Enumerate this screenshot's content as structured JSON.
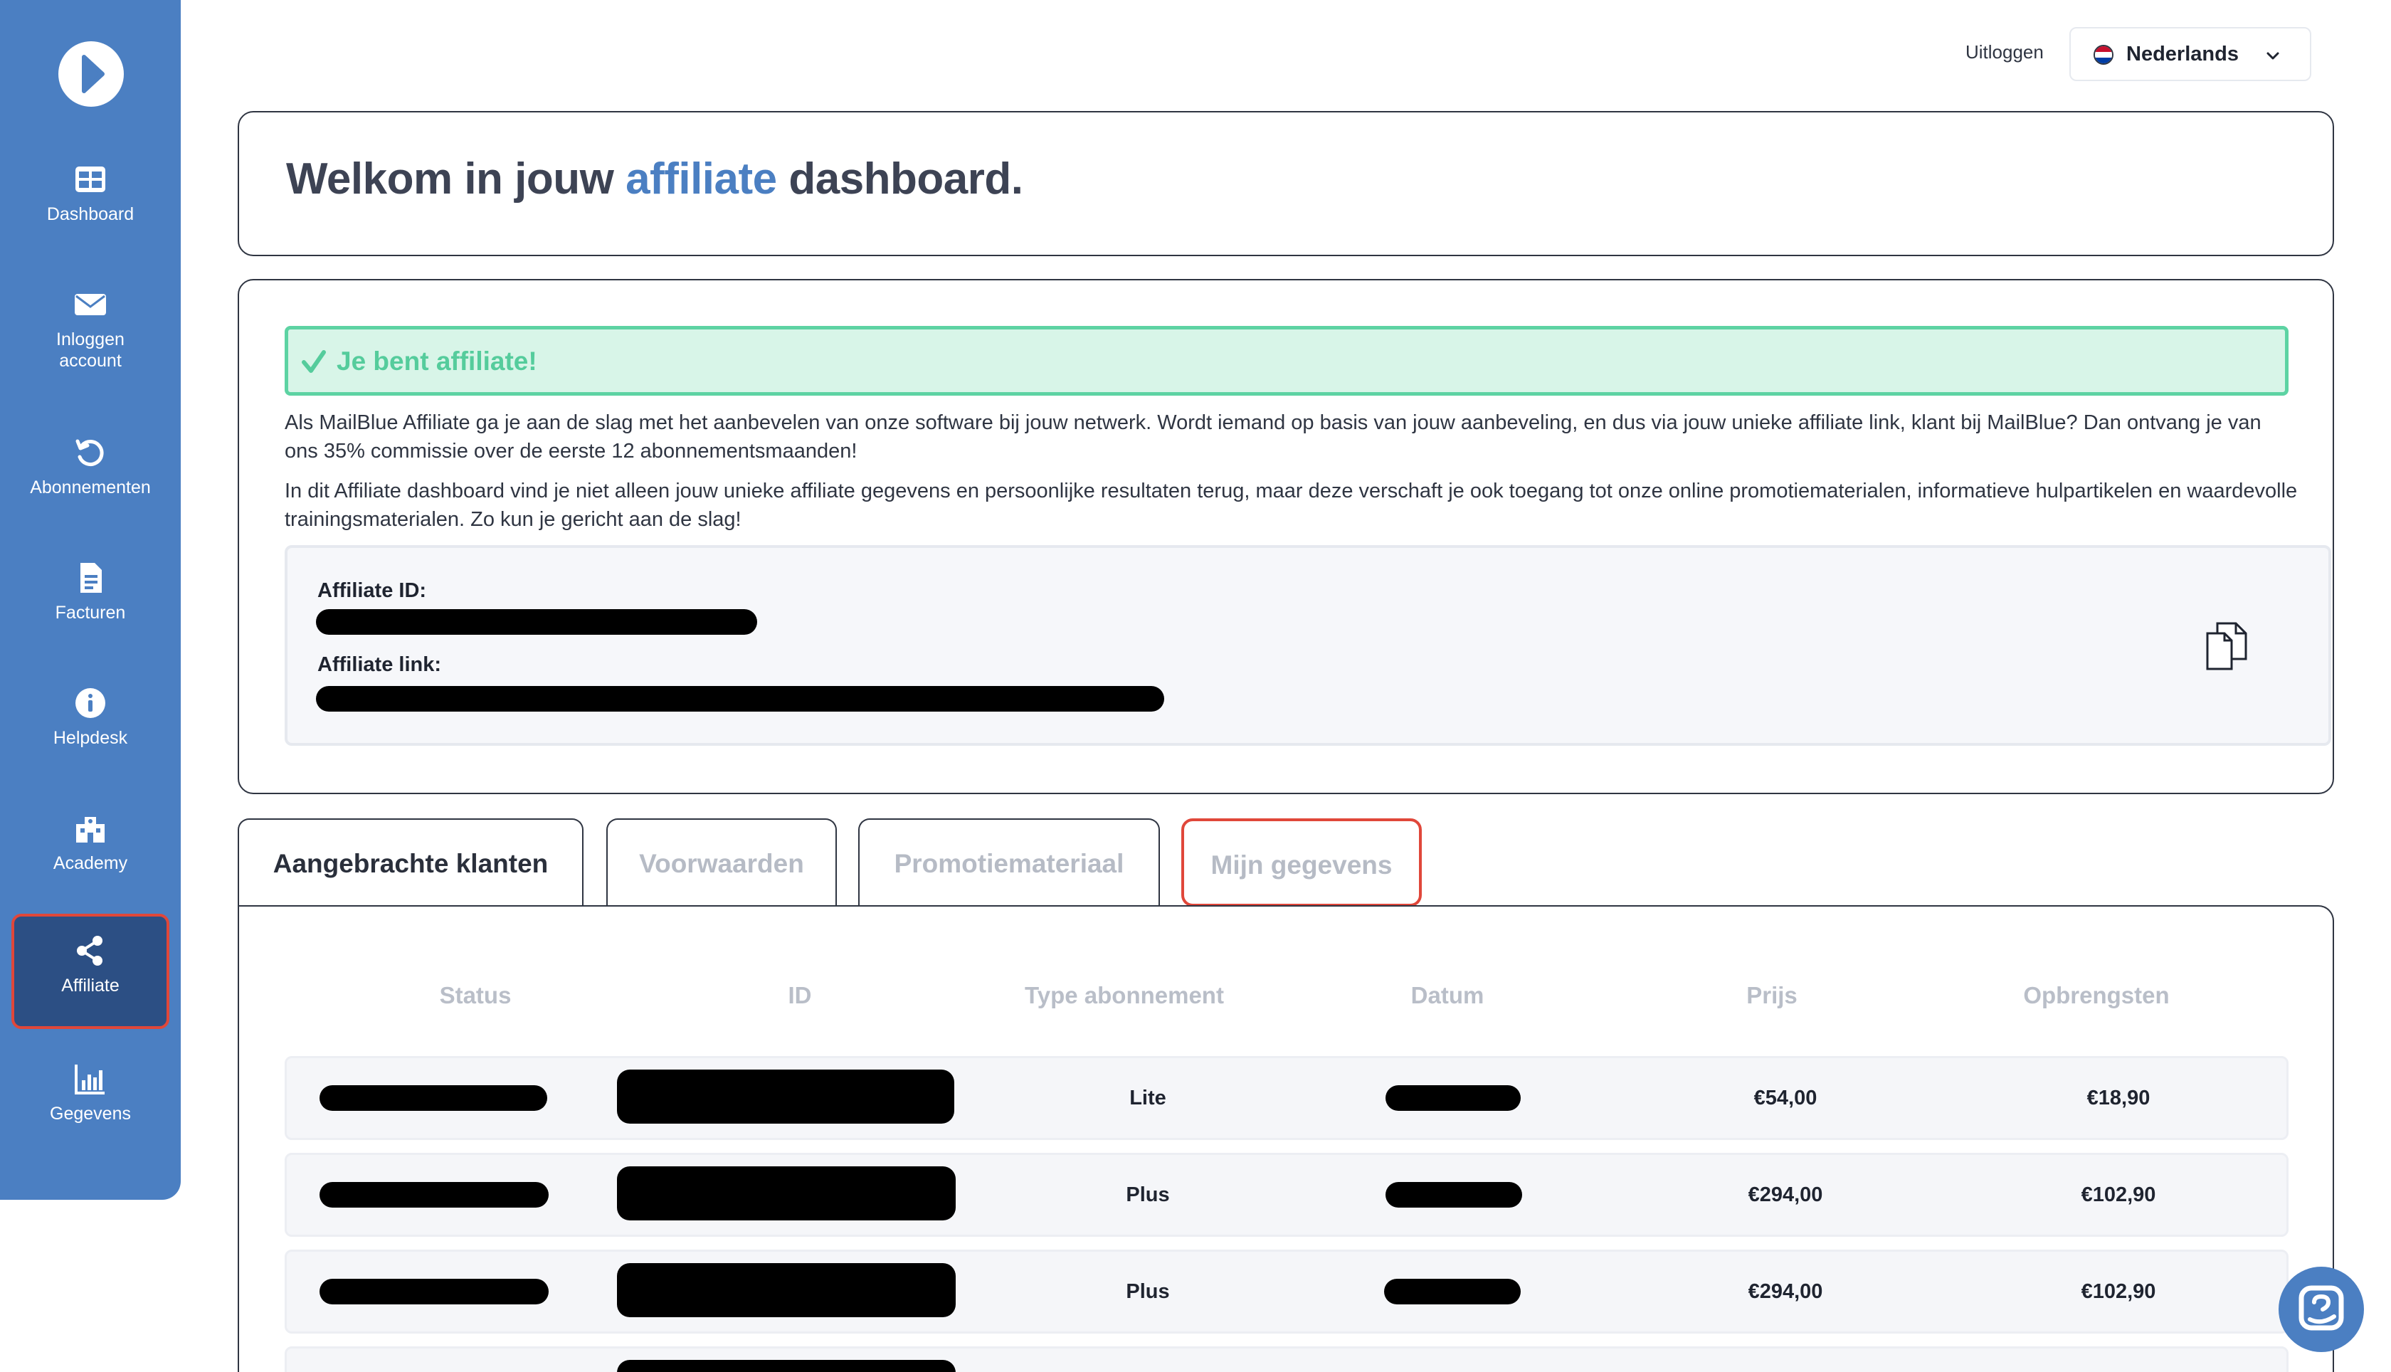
{
  "sidebar": {
    "items": [
      {
        "label": "Dashboard",
        "icon": "grid-icon"
      },
      {
        "label": "Inloggen account",
        "icon": "envelope-icon"
      },
      {
        "label": "Abonnementen",
        "icon": "refresh-icon"
      },
      {
        "label": "Facturen",
        "icon": "document-icon"
      },
      {
        "label": "Helpdesk",
        "icon": "info-icon"
      },
      {
        "label": "Academy",
        "icon": "academy-icon"
      },
      {
        "label": "Affiliate",
        "icon": "share-icon"
      },
      {
        "label": "Gegevens",
        "icon": "bar-chart-icon"
      }
    ],
    "active": "Affiliate",
    "bg_color": "#4b7fc2",
    "active_color": "#2c4f84"
  },
  "header": {
    "logout_label": "Uitloggen",
    "language": "Nederlands"
  },
  "welcome": {
    "title_part1": "Welkom in jouw ",
    "title_accent": "affiliate",
    "title_part2": " dashboard."
  },
  "affiliate_info": {
    "status": "Je bent affiliate!",
    "paragraph1": "Als MailBlue Affiliate ga je aan de slag met het aanbevelen van onze software bij jouw netwerk. Wordt iemand op basis van jouw aanbeveling, en dus via jouw unieke affiliate link, klant bij MailBlue? Dan ontvang je van ons 35% commissie over de eerste 12 abonnementsmaanden!",
    "paragraph2": "In dit Affiliate dashboard vind je niet alleen jouw unieke affiliate gegevens en persoonlijke resultaten terug, maar deze verschaft je ook toegang tot onze online promotiematerialen, informatieve hulpartikelen en waardevolle trainingsmaterialen. Zo kun je gericht aan de slag!",
    "id_label": "Affiliate ID:",
    "link_label": "Affiliate link:"
  },
  "tabs": [
    {
      "label": "Aangebrachte klanten",
      "active": true
    },
    {
      "label": "Voorwaarden",
      "active": false
    },
    {
      "label": "Promotiemateriaal",
      "active": false
    },
    {
      "label": "Mijn gegevens",
      "active": false
    }
  ],
  "table": {
    "columns": [
      "Status",
      "ID",
      "Type abonnement",
      "Datum",
      "Prijs",
      "Opbrengsten"
    ],
    "rows": [
      {
        "type": "Lite",
        "price": "€54,00",
        "revenue": "€18,90"
      },
      {
        "type": "Plus",
        "price": "€294,00",
        "revenue": "€102,90"
      },
      {
        "type": "Plus",
        "price": "€294,00",
        "revenue": "€102,90"
      }
    ]
  },
  "colors": {
    "accent": "#4b7fc2",
    "success_bg": "#d8f5e8",
    "success_border": "#5dd3a3",
    "highlight": "#e0473a"
  }
}
